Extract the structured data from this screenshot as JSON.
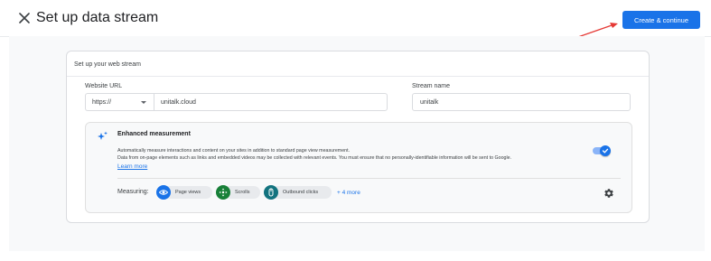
{
  "header": {
    "title": "Set up data stream",
    "primary_button": "Create & continue"
  },
  "card": {
    "title": "Set up your web stream",
    "website_url": {
      "label": "Website URL",
      "protocol": "https://",
      "value": "unitalk.cloud"
    },
    "stream_name": {
      "label": "Stream name",
      "value": "unitalk"
    }
  },
  "enhanced": {
    "title": "Enhanced measurement",
    "desc_line1": "Automatically measure interactions and content on your sites in addition to standard page view measurement.",
    "desc_line2": "Data from on-page elements such as links and embedded videos may be collected with relevant events. You must ensure that no personally-identifiable information will be sent to Google.",
    "learn_more": "Learn more",
    "toggle_on": true,
    "measuring_label": "Measuring:",
    "chips": [
      {
        "label": "Page views",
        "icon": "eye-icon",
        "color": "#1a73e8"
      },
      {
        "label": "Scrolls",
        "icon": "crosshair-icon",
        "color": "#188038"
      },
      {
        "label": "Outbound clicks",
        "icon": "mouse-icon",
        "color": "#12737f"
      }
    ],
    "more_link": "+ 4 more"
  },
  "colors": {
    "accent": "#1a73e8",
    "annotation_arrow": "#e53935"
  }
}
